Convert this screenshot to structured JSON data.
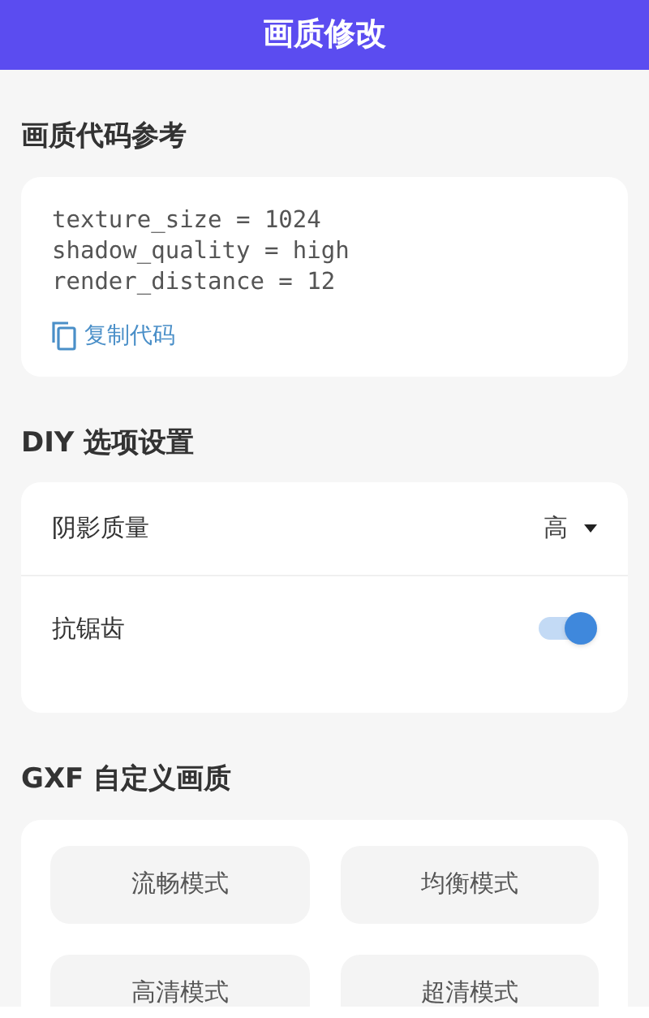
{
  "header": {
    "title": "画质修改"
  },
  "code_section": {
    "title": "画质代码参考",
    "lines": [
      "texture_size = 1024",
      "shadow_quality = high",
      "render_distance = 12"
    ],
    "copy_label": "复制代码"
  },
  "diy_section": {
    "title": "DIY 选项设置",
    "options": [
      {
        "kind": "dropdown",
        "label": "阴影质量",
        "value": "高"
      },
      {
        "kind": "toggle",
        "label": "抗锯齿",
        "on": true
      }
    ]
  },
  "gxf_section": {
    "title": "GXF 自定义画质",
    "modes": [
      {
        "label": "流畅模式",
        "selected": false
      },
      {
        "label": "均衡模式",
        "selected": false
      },
      {
        "label": "高清模式",
        "selected": false
      },
      {
        "label": "超清模式",
        "selected": false
      }
    ]
  }
}
